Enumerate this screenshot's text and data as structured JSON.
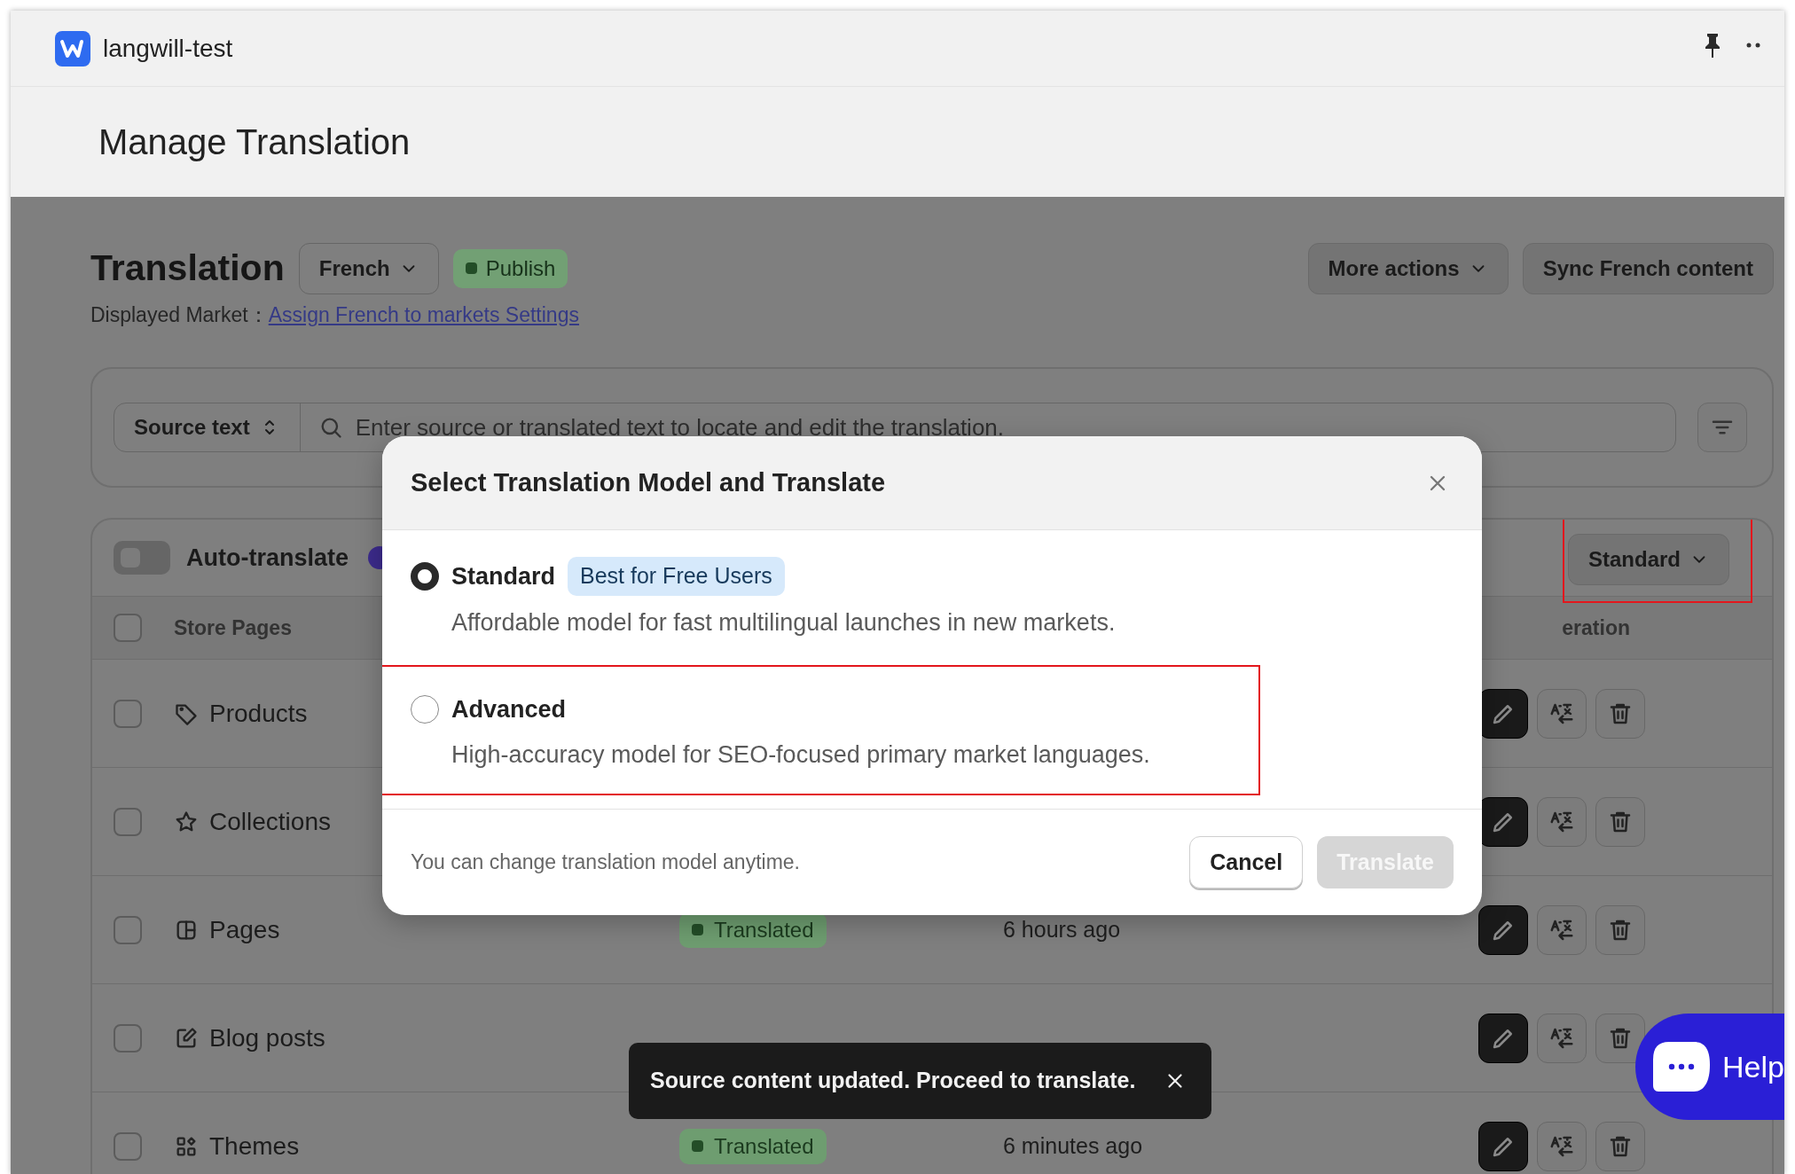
{
  "app": {
    "name": "langwill-test"
  },
  "page_title": "Manage Translation",
  "header": {
    "title": "Translation",
    "language": "French",
    "status": "Publish",
    "market_label": "Displayed Market：",
    "market_link": "Assign French to markets Settings",
    "actions": [
      {
        "label": "More actions",
        "kind": "dropdown"
      },
      {
        "label": "Sync French content",
        "kind": "plain"
      }
    ]
  },
  "search": {
    "mode": "Source text",
    "placeholder": "Enter source or translated text to locate and edit the translation."
  },
  "table": {
    "auto_translate": {
      "label": "Auto-translate",
      "on": false
    },
    "model": {
      "label": "Standard",
      "highlighted": true
    },
    "all_checked": false,
    "columns": [
      "Store Pages",
      "eration"
    ],
    "rows": [
      {
        "name": "Products",
        "kind": "tag",
        "checked": false
      },
      {
        "name": "Collections",
        "kind": "star",
        "checked": false
      },
      {
        "name": "Pages",
        "kind": "layout",
        "checked": false,
        "status": "Translated",
        "time": "6 hours ago"
      },
      {
        "name": "Blog posts",
        "kind": "edit",
        "checked": false
      },
      {
        "name": "Themes",
        "kind": "themes",
        "checked": false,
        "status": "Translated",
        "time": "6 minutes ago"
      }
    ]
  },
  "modal": {
    "title": "Select Translation Model and Translate",
    "options": [
      {
        "name": "Standard",
        "badge": "Best for Free Users",
        "description": "Affordable model for fast multilingual launches in new markets.",
        "selected": true
      },
      {
        "name": "Advanced",
        "description": "High-accuracy model for SEO-focused primary market languages.",
        "selected": false,
        "highlighted": true
      }
    ],
    "note": "You can change translation model anytime.",
    "buttons": [
      {
        "label": "Cancel",
        "kind": "secondary"
      },
      {
        "label": "Translate",
        "kind": "primary",
        "disabled": true
      }
    ]
  },
  "toast": {
    "message": "Source content updated. Proceed to translate."
  },
  "help": {
    "label": "Help"
  }
}
